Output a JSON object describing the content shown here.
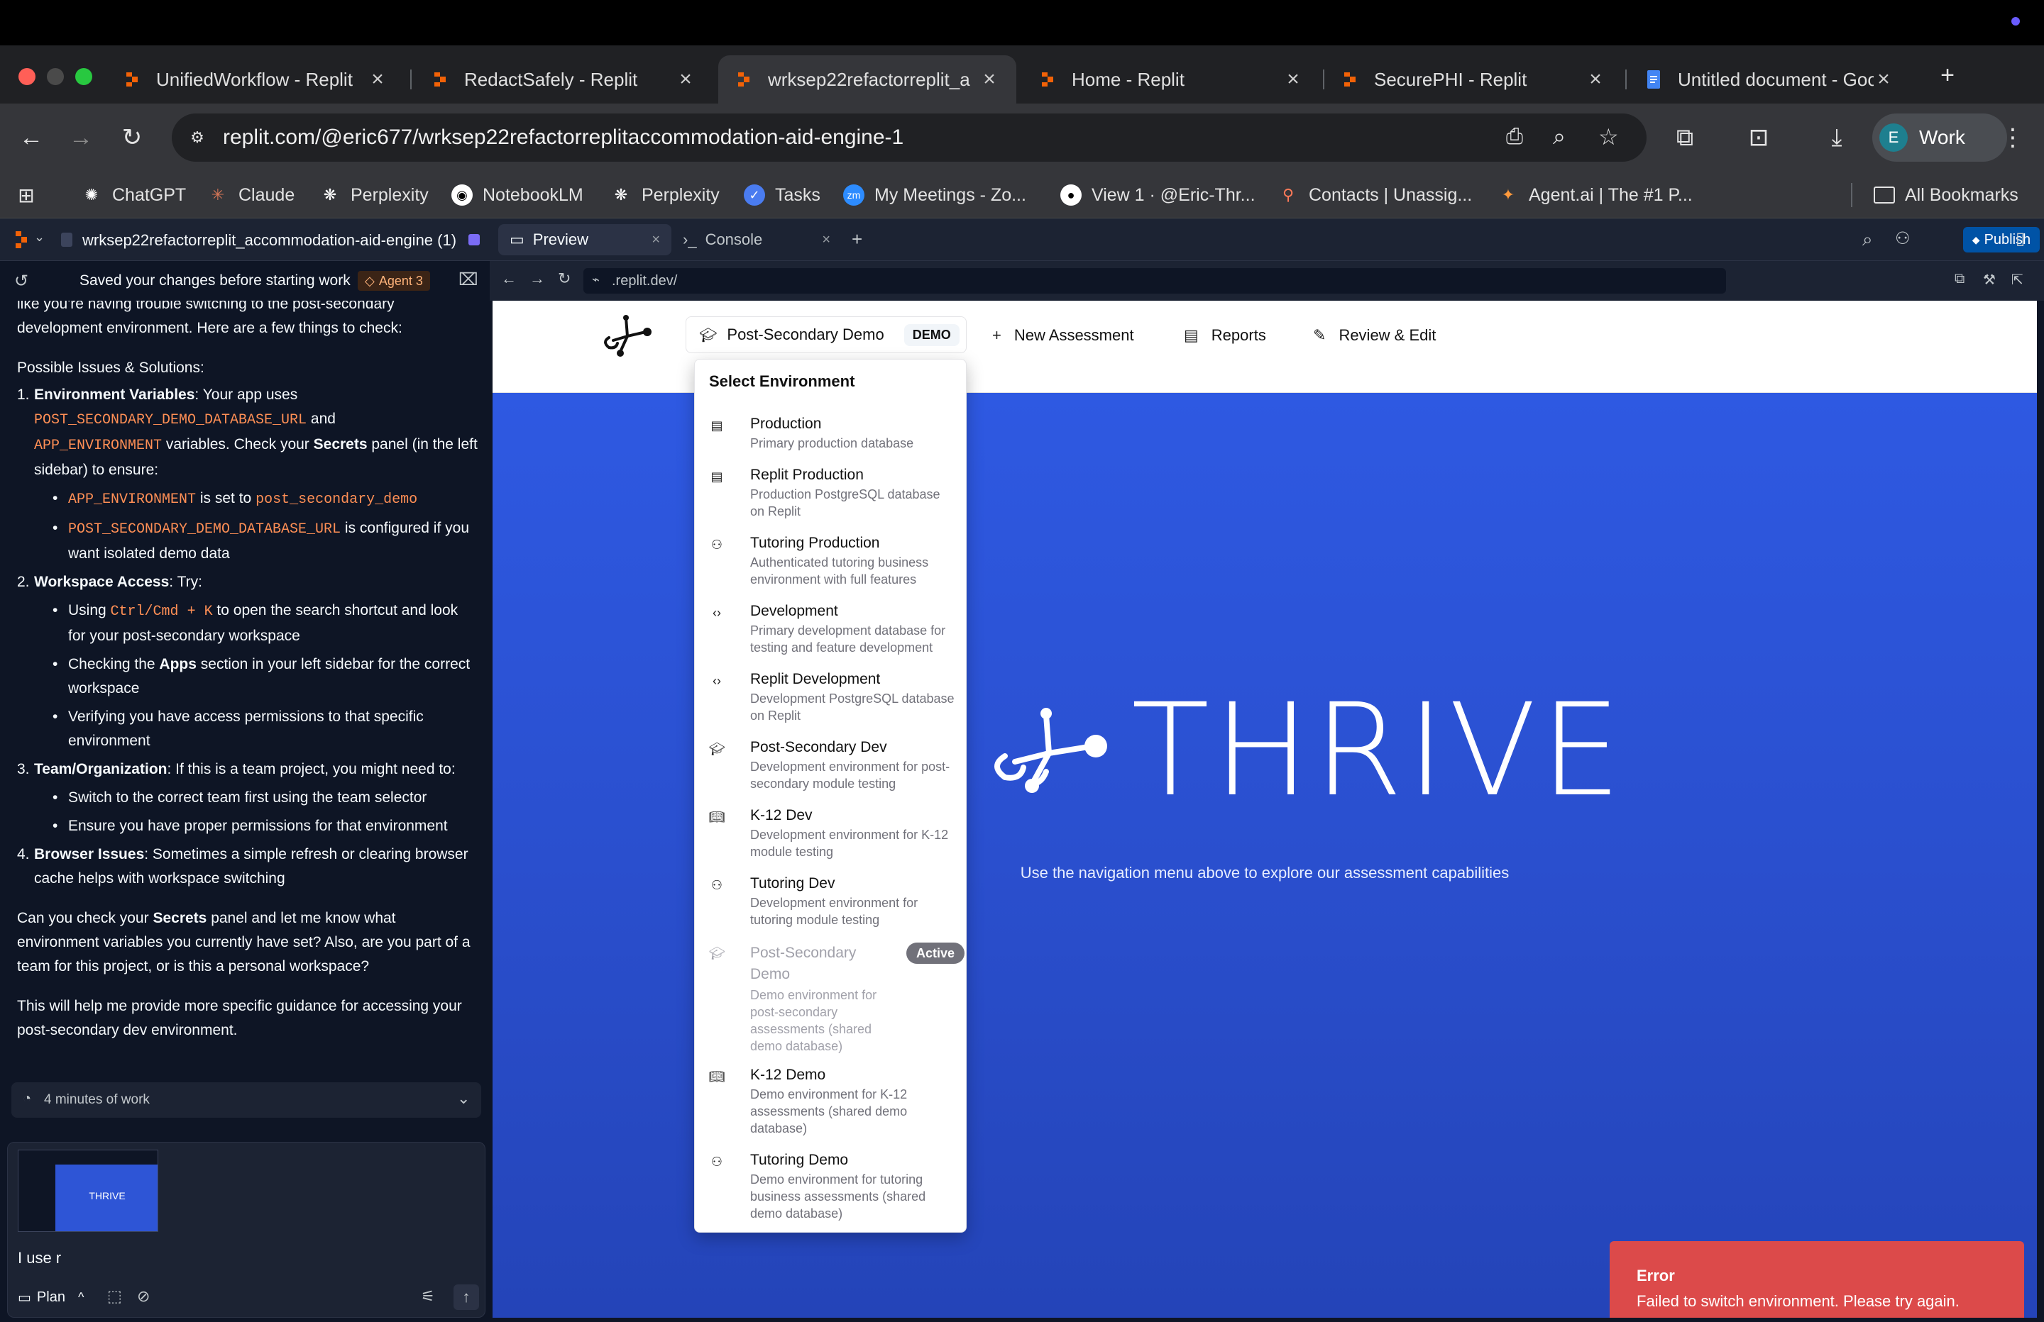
{
  "browser": {
    "tabs": [
      {
        "title": "UnifiedWorkflow - Replit"
      },
      {
        "title": "RedactSafely - Replit"
      },
      {
        "title": "wrksep22refactorreplit_a"
      },
      {
        "title": "Home - Replit"
      },
      {
        "title": "SecurePHI - Replit"
      },
      {
        "title": "Untitled document - Goo"
      }
    ],
    "url": "replit.com/@eric677/wrksep22refactorreplitaccommodation-aid-engine-1",
    "profile_initial": "E",
    "profile_label": "Work",
    "bookmarks": [
      {
        "label": "ChatGPT"
      },
      {
        "label": "Claude"
      },
      {
        "label": "Perplexity"
      },
      {
        "label": "NotebookLM"
      },
      {
        "label": "Perplexity"
      },
      {
        "label": "Tasks"
      },
      {
        "label": "My Meetings - Zo..."
      },
      {
        "label": "View 1 · @Eric-Thr..."
      },
      {
        "label": "Contacts | Unassig..."
      },
      {
        "label": "Agent.ai | The #1 P..."
      },
      {
        "label": "All Bookmarks"
      }
    ]
  },
  "replit": {
    "project_name": "wrksep22refactorreplit_accommodation-aid-engine (1)",
    "tabs": {
      "preview": "Preview",
      "console": "Console"
    },
    "publish_label": "Publish",
    "preview_url": ".replit.dev/"
  },
  "agent": {
    "saved_text": "Saved your changes before starting work",
    "agent_badge": "Agent 3",
    "intro_partial": "Based on the Replit documentation and our previous work, it seems like you're having trouble switching to the post-secondary development environment. Here are a few things to check:",
    "issues_heading": "Possible Issues & Solutions:",
    "item1": {
      "num": "1.",
      "title": "Environment Variables",
      "t1": ": Your app uses",
      "code1": "POST_SECONDARY_DEMO_DATABASE_URL",
      "t2": "and",
      "code2": "APP_ENVIRONMENT",
      "t3": "variables. Check your",
      "secrets": "Secrets",
      "t4": "panel (in the left sidebar) to ensure:",
      "b1_code": "APP_ENVIRONMENT",
      "b1_text": "is set to",
      "b1_code2": "post_secondary_demo",
      "b2_code": "POST_SECONDARY_DEMO_DATABASE_URL",
      "b2_text": "is configured if you want isolated demo data"
    },
    "item2": {
      "num": "2.",
      "title": "Workspace Access",
      "t1": ": Try:",
      "b1_pre": "Using",
      "b1_code": "Ctrl/Cmd + K",
      "b1_post": "to open the search shortcut and look for your post-secondary workspace",
      "b2_pre": "Checking the",
      "b2_bold": "Apps",
      "b2_post": "section in your left sidebar for the correct workspace",
      "b3": "Verifying you have access permissions to that specific environment"
    },
    "item3": {
      "num": "3.",
      "title": "Team/Organization",
      "t1": ": If this is a team project, you might need to:",
      "b1": "Switch to the correct team first using the team selector",
      "b2": "Ensure you have proper permissions for that environment"
    },
    "item4": {
      "num": "4.",
      "title": "Browser Issues",
      "t1": ": Sometimes a simple refresh or clearing browser cache helps with workspace switching"
    },
    "question_pre": "Can you check your",
    "question_bold": "Secrets",
    "question_post": "panel and let me know what environment variables you currently have set? Also, are you part of a team for this project, or is this a personal workspace?",
    "closing": "This will help me provide more specific guidance for accessing your post-secondary dev environment.",
    "work_duration": "4 minutes of work",
    "thumb_text": "THRIVE",
    "input_text": "I use r",
    "plan_label": "Plan"
  },
  "app": {
    "env_button_label": "Post-Secondary Demo",
    "env_badge": "DEMO",
    "nav": {
      "new_assessment": "New Assessment",
      "reports": "Reports",
      "review_edit": "Review & Edit"
    },
    "hero_word": "THRIVE",
    "hero_sub": "Use the navigation menu above to explore our assessment capabilities",
    "dropdown": {
      "heading": "Select Environment",
      "options": [
        {
          "name": "Production",
          "desc": [
            "Primary production database"
          ],
          "icon": "server-icon"
        },
        {
          "name": "Replit Production",
          "desc": [
            "Production PostgreSQL database",
            "on Replit"
          ],
          "icon": "server-icon"
        },
        {
          "name": "Tutoring Production",
          "desc": [
            "Authenticated tutoring business",
            "environment with full features"
          ],
          "icon": "user-check-icon"
        },
        {
          "name": "Development",
          "desc": [
            "Primary development database for",
            "testing and feature development"
          ],
          "icon": "code-icon"
        },
        {
          "name": "Replit Development",
          "desc": [
            "Development PostgreSQL database",
            "on Replit"
          ],
          "icon": "code-icon"
        },
        {
          "name": "Post-Secondary Dev",
          "desc": [
            "Development environment for post-",
            "secondary module testing"
          ],
          "icon": "graduation-cap-icon"
        },
        {
          "name": "K-12 Dev",
          "desc": [
            "Development environment for K-12",
            "module testing"
          ],
          "icon": "book-icon"
        },
        {
          "name": "Tutoring Dev",
          "desc": [
            "Development environment for",
            "tutoring module testing"
          ],
          "icon": "users-icon"
        },
        {
          "name": [
            "Post-Secondary",
            "Demo"
          ],
          "desc": [
            "Demo environment for",
            "post-secondary",
            "assessments (shared",
            "demo database)"
          ],
          "icon": "graduation-cap-icon",
          "badge": "Active"
        },
        {
          "name": "K-12 Demo",
          "desc": [
            "Demo environment for K-12",
            "assessments (shared demo",
            "database)"
          ],
          "icon": "book-icon"
        },
        {
          "name": "Tutoring Demo",
          "desc": [
            "Demo environment for tutoring",
            "business assessments (shared",
            "demo database)"
          ],
          "icon": "users-icon"
        }
      ]
    },
    "toast": {
      "title": "Error",
      "message": "Failed to switch environment. Please try again."
    }
  }
}
